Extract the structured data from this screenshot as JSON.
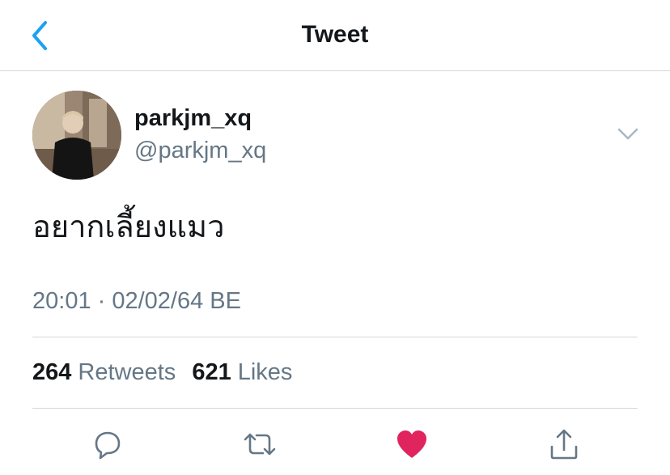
{
  "header": {
    "title": "Tweet",
    "back_icon": "chevron-left-icon"
  },
  "tweet": {
    "display_name": "parkjm_xq",
    "handle": "@parkjm_xq",
    "text": "อยากเลี้ยงแมว",
    "timestamp": "20:01 · 02/02/64 BE",
    "retweets_count": "264",
    "retweets_label": "Retweets",
    "likes_count": "621",
    "likes_label": "Likes",
    "liked": true
  },
  "actions": [
    {
      "icon": "reply-icon"
    },
    {
      "icon": "retweet-icon"
    },
    {
      "icon": "heart-icon"
    },
    {
      "icon": "share-icon"
    }
  ],
  "colors": {
    "accent": "#1da1f2",
    "like": "#e0245e",
    "secondary_text": "#657786",
    "divider": "#d6d6d6"
  }
}
